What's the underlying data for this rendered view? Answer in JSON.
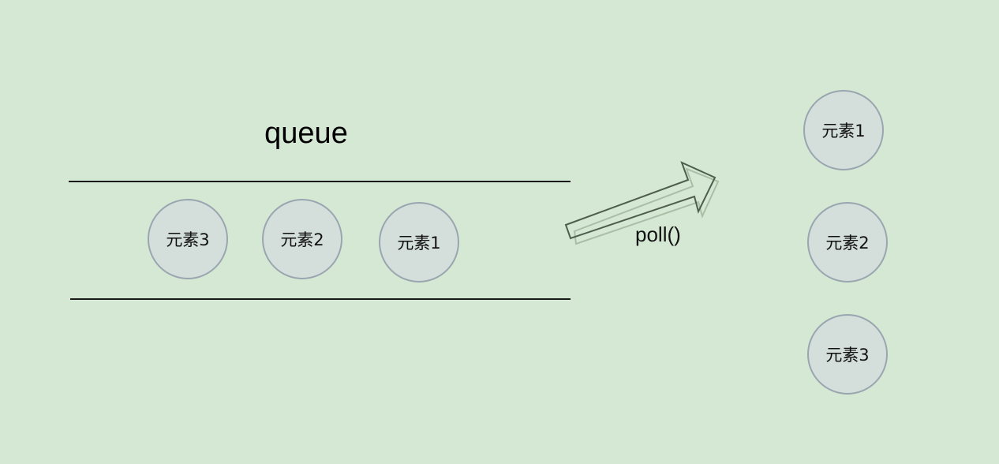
{
  "diagram": {
    "queue_label": "queue",
    "queue_elements": [
      "元素3",
      "元素2",
      "元素1"
    ],
    "operation_label": "poll()",
    "output_elements": [
      "元素1",
      "元素2",
      "元素3"
    ],
    "colors": {
      "background": "#d5e8d4",
      "node_fill": "#d4dedb",
      "node_border": "#9aa6af",
      "line": "#1a1a1a",
      "arrow_stroke": "#4d5e4d"
    }
  }
}
